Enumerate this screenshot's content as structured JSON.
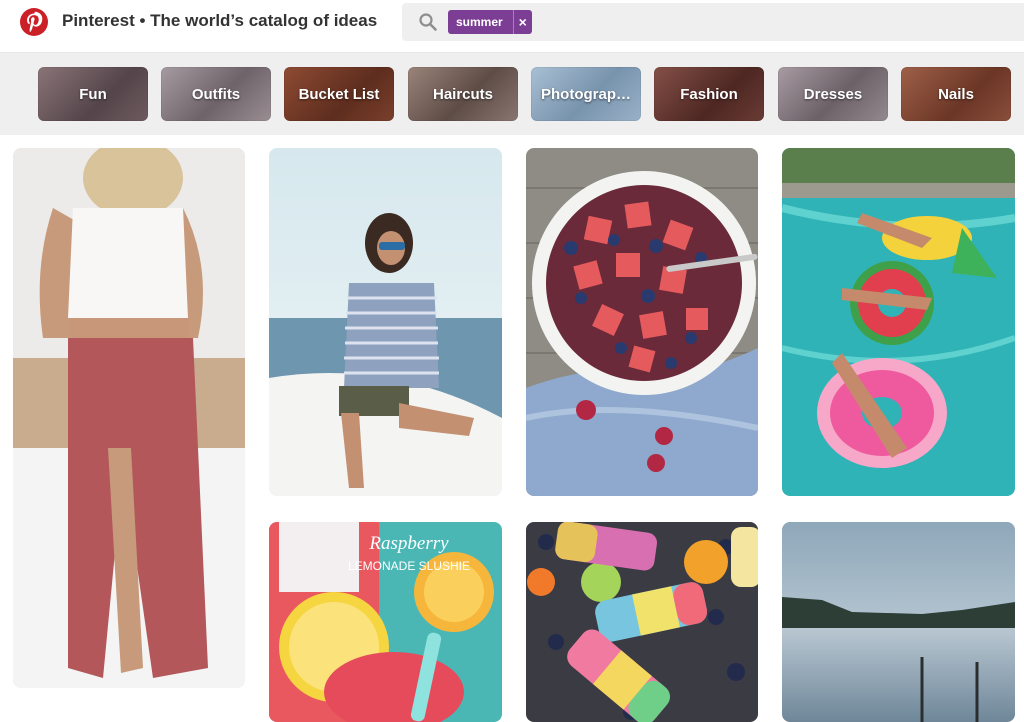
{
  "header": {
    "title": "Pinterest • The world’s catalog of ideas",
    "search": {
      "query_chip": "summer",
      "chip_close": "×",
      "placeholder": ""
    }
  },
  "guides": [
    {
      "label": "Fun",
      "color": "#6e5a5e"
    },
    {
      "label": "Outfits",
      "color": "#8c7f86"
    },
    {
      "label": "Bucket List",
      "color": "#7a3f2c"
    },
    {
      "label": "Haircuts",
      "color": "#7d6a63"
    },
    {
      "label": "Photograp…",
      "color": "#8ba6bf"
    },
    {
      "label": "Fashion",
      "color": "#6a3b35"
    },
    {
      "label": "Dresses",
      "color": "#8e8288"
    },
    {
      "label": "Nails",
      "color": "#8a4e3c"
    }
  ],
  "pins": [
    {
      "name": "pin-woman-red-skirt",
      "icon": "photo-woman-white-top"
    },
    {
      "name": "pin-woman-striped-hoodie",
      "icon": "photo-woman-boat"
    },
    {
      "name": "pin-watermelon-bowl",
      "icon": "photo-fruit-bowl"
    },
    {
      "name": "pin-pool-floats",
      "icon": "photo-pool"
    },
    {
      "name": "pin-raspberry-slushie",
      "icon": "photo-drink",
      "overlay_line1": "Raspberry",
      "overlay_line2": "LEMONADE SLUSHIE"
    },
    {
      "name": "pin-rainbow-popsicles",
      "icon": "photo-popsicles"
    },
    {
      "name": "pin-lake",
      "icon": "photo-lake"
    }
  ]
}
